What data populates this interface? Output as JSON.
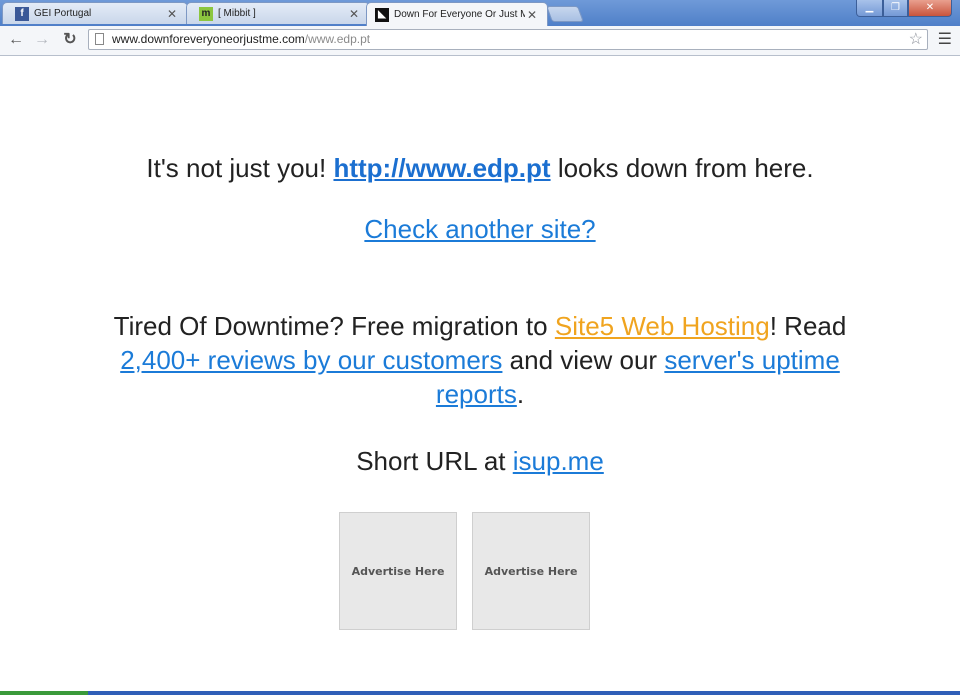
{
  "tabs": [
    {
      "title": "GEI Portugal",
      "favicon": "facebook-icon",
      "active": false
    },
    {
      "title": "[ Mibbit ]",
      "favicon": "mibbit-icon",
      "active": false
    },
    {
      "title": "Down For Everyone Or Just Me",
      "favicon": "dfeojm-icon",
      "active": true
    }
  ],
  "toolbar": {
    "url_host": "www.downforeveryoneorjustme.com",
    "url_path": "/www.edp.pt"
  },
  "page": {
    "line1_prefix": "It's not just you!",
    "checked_site": "http://www.edp.pt",
    "line1_suffix": "looks down from here.",
    "check_another": "Check another site?",
    "promo_part1": "Tired Of Downtime? Free migration to",
    "promo_host_link": "Site5 Web Hosting",
    "promo_part2": "! Read",
    "promo_reviews_link": "2,400+ reviews by our customers",
    "promo_part3": "and view our",
    "promo_uptime_link": "server's uptime reports",
    "promo_part4": ".",
    "short_prefix": "Short URL at",
    "short_link": "isup.me",
    "ad1": "Advertise Here",
    "ad2": "Advertise Here"
  },
  "colors": {
    "link": "#1b7bd8",
    "host_link": "#f0a41f",
    "tabstrip": "#5a88cf"
  }
}
